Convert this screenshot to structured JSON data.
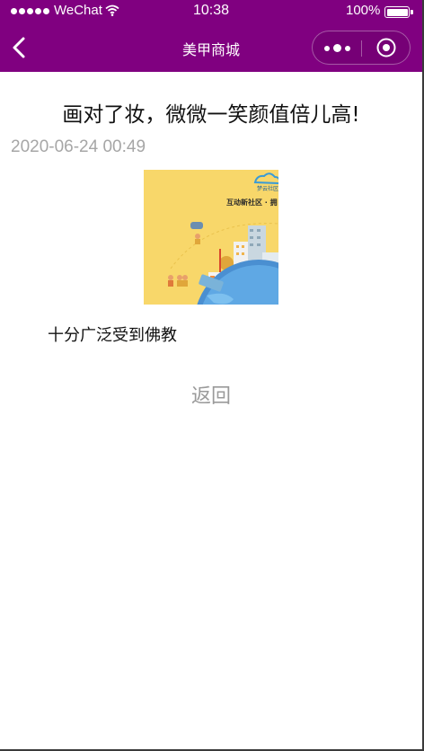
{
  "status_bar": {
    "carrier": "WeChat",
    "time": "10:38",
    "battery": "100%",
    "battery_level": 1.0
  },
  "nav": {
    "title": "美甲商城",
    "back_icon": "chevron-left-icon",
    "more_icon": "more-dots-icon",
    "close_icon": "target-circle-icon",
    "background": "#800080"
  },
  "article": {
    "title": "画对了妆，微微一笑颜值倍儿高!",
    "date": "2020-06-24 00:49",
    "image_text": "互动新社区 · 拥",
    "image_brand": "梦云社区",
    "body": "十分广泛受到佛教"
  },
  "actions": {
    "return_label": "返回"
  }
}
